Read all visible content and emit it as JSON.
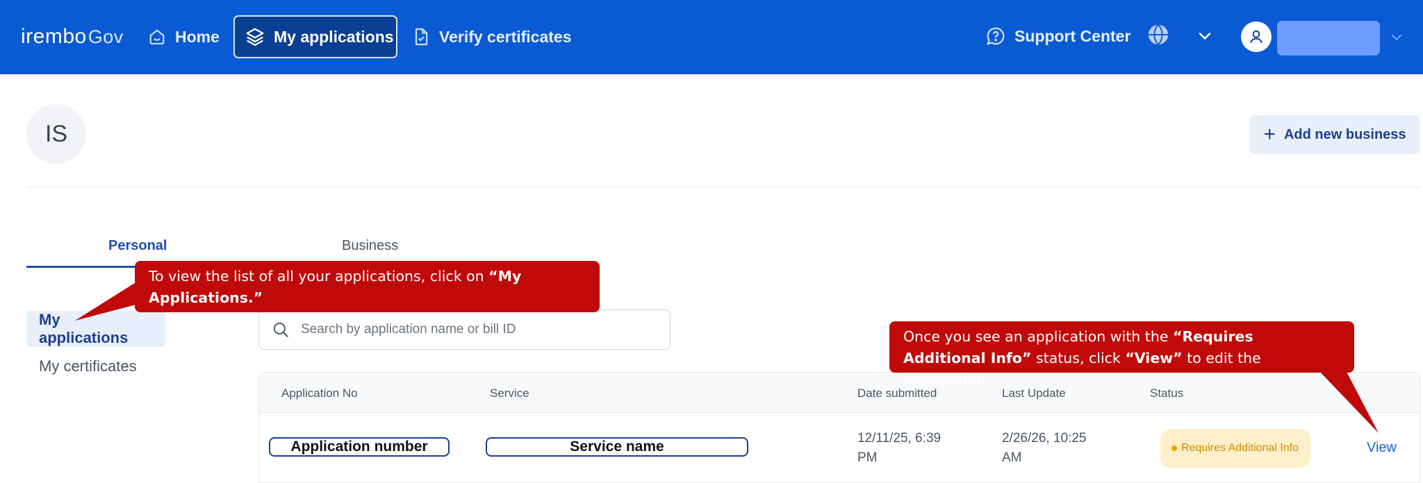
{
  "brand": {
    "logo_main": "irembo",
    "logo_suffix": "Gov"
  },
  "nav": {
    "home": "Home",
    "my_applications": "My applications",
    "verify_certificates": "Verify certificates",
    "support_center": "Support Center"
  },
  "profile": {
    "initials": "IS",
    "add_business": "Add new business"
  },
  "tabs": {
    "personal": "Personal",
    "business": "Business"
  },
  "sidebar": {
    "my_applications": "My applications",
    "my_certificates": "My certificates"
  },
  "search": {
    "placeholder": "Search by application name or bill ID",
    "value": ""
  },
  "table": {
    "headers": {
      "application_no": "Application No",
      "service": "Service",
      "date_submitted": "Date submitted",
      "last_update": "Last Update",
      "status": "Status"
    },
    "rows": [
      {
        "application_no": "Application number",
        "service": "Service name",
        "date_submitted_1": "12/11/25, 6:39",
        "date_submitted_2": "PM",
        "last_update_1": "2/26/26, 10:25",
        "last_update_2": "AM",
        "status": "Requires Additional Info",
        "action": "View"
      }
    ]
  },
  "callouts": {
    "first_text": "To view the list of all your applications, click on ",
    "first_bold": "“My Applications.”",
    "second_text_1": "Once you see an application with the ",
    "second_bold_1": "“Requires Additional Info”",
    "second_text_2": " status, click ",
    "second_bold_2": "“View”",
    "second_text_3": " to edit the information."
  },
  "colors": {
    "topbar": "#0a5bd3",
    "accent": "#1d4fa8",
    "callout": "#c00a0a",
    "status_badge": "#fdf0c8",
    "status_text": "#d08a00"
  },
  "icons": [
    "home-icon",
    "layers-icon",
    "file-check-icon",
    "help-chat-icon",
    "globe-icon",
    "chevron-down-icon",
    "user-icon",
    "plus-icon",
    "search-icon"
  ]
}
